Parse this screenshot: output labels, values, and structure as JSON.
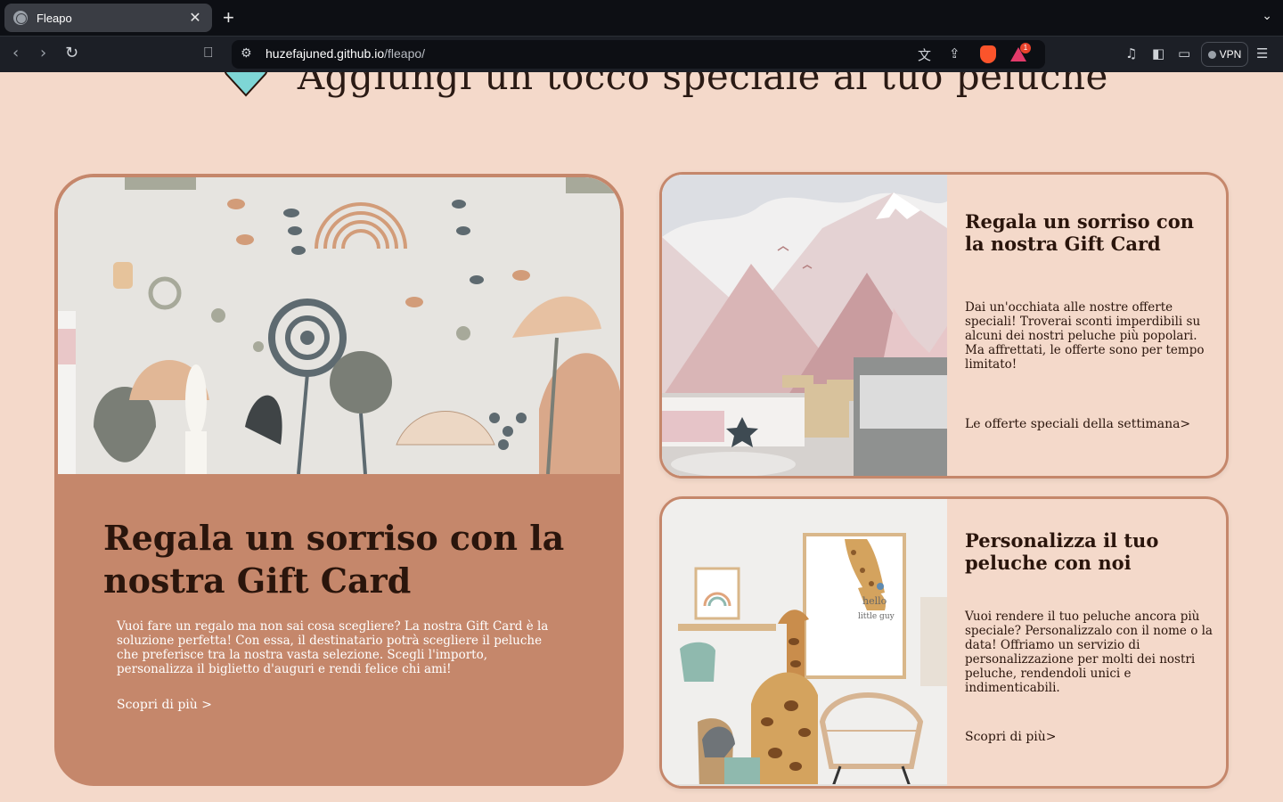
{
  "browser": {
    "tab_title": "Fleapo",
    "tab_close": "✕",
    "new_tab": "+",
    "url_host": "huzefajuned.github.io",
    "url_path": "/fleapo/",
    "vpn_label": "VPN",
    "notification_count": "1",
    "icons": [
      "globe-icon",
      "close-icon",
      "plus-icon",
      "chevron-down-icon",
      "back-icon",
      "forward-icon",
      "reload-icon",
      "bookmark-icon",
      "site-settings-icon",
      "translate-icon",
      "share-icon",
      "brave-shields-icon",
      "brave-rewards-icon",
      "media-icon",
      "sidebar-icon",
      "wallet-icon",
      "menu-icon"
    ]
  },
  "page": {
    "heading": "\"Aggiungi un tocco speciale al tuo peluche\"",
    "accent_color": "#c5876b",
    "background_color": "#f4d9ca",
    "heart_color": "#7ed6d6",
    "big_card": {
      "title": "Regala un sorriso con la nostra Gift Card",
      "description": "Vuoi fare un regalo ma non sai cosa scegliere? La nostra Gift Card è la soluzione perfetta! Con essa, il destinatario potrà scegliere il peluche che preferisce tra la nostra vasta selezione. Scegli l'importo, personalizza il biglietto d'auguri e rendi felice chi ami!",
      "link": "Scopri di più >"
    },
    "card1": {
      "title": "Regala un sorriso con la nostra Gift Card",
      "description": "Dai un'occhiata alle nostre offerte speciali! Troverai sconti imperdibili su alcuni dei nostri peluche più popolari. Ma affrettati, le offerte sono per tempo limitato!",
      "link": "Le offerte speciali della settimana>"
    },
    "card2": {
      "title": "Personalizza il tuo peluche con noi",
      "description": "Vuoi rendere il tuo peluche ancora più speciale? Personalizzalo con il nome o la data! Offriamo un servizio di personalizzazione per molti dei nostri peluche, rendendoli unici e indimenticabili.",
      "link": "Scopri di più>",
      "image_text_line1": "hello",
      "image_text_line2": "little guy"
    }
  }
}
